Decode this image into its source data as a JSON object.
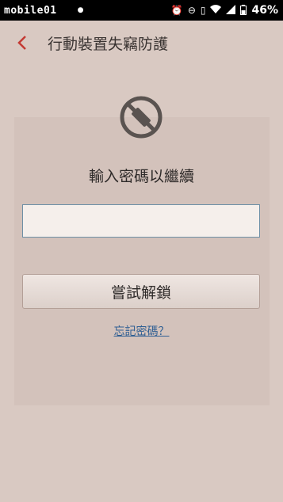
{
  "status_bar": {
    "brand": "mobile01",
    "battery_percent": "46%"
  },
  "header": {
    "title": "行動裝置失竊防護"
  },
  "dialog": {
    "prompt": "輸入密碼以繼續",
    "password_value": "",
    "unlock_button_label": "嘗試解鎖",
    "forgot_password_link": "忘記密碼？"
  },
  "colors": {
    "accent": "#c33a33",
    "link": "#2f5f93",
    "field_border": "#6d8fa6",
    "background": "#d9c9c2"
  }
}
